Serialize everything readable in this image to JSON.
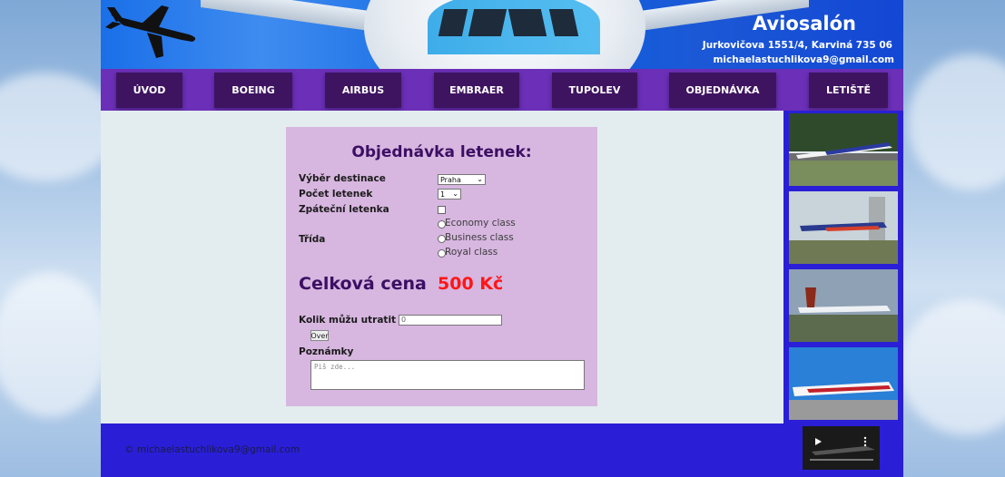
{
  "header": {
    "title": "Aviosalón",
    "address": "Jurkovičova 1551/4, Karviná 735 06",
    "email": "michaelastuchlikova9@gmail.com"
  },
  "nav": {
    "items": [
      {
        "label": "ÚVOD"
      },
      {
        "label": "BOEING"
      },
      {
        "label": "AIRBUS"
      },
      {
        "label": "EMBRAER"
      },
      {
        "label": "TUPOLEV"
      },
      {
        "label": "OBJEDNÁVKA"
      },
      {
        "label": "LETIŠTĚ"
      }
    ]
  },
  "form": {
    "title": "Objednávka letenek:",
    "destination_label": "Výběr destinace",
    "destination_value": "Praha",
    "tickets_label": "Počet letenek",
    "tickets_value": "1",
    "return_label": "Zpáteční letenka",
    "class_label": "Třída",
    "classes": [
      "Economy class",
      "Business class",
      "Royal class"
    ],
    "total_label": "Celková cena",
    "total_value": "500 Kč",
    "budget_label": "Kolik můžu utratit",
    "budget_value": "0",
    "check_button": "Over",
    "notes_label": "Poznámky",
    "notes_placeholder": "Piš zde..."
  },
  "footer": {
    "copyright": "©  michaelastuchlikova9@gmail.com"
  },
  "colors": {
    "nav_bg": "#6b2fb8",
    "nav_button": "#3e1460",
    "card_bg": "#d7b6e0",
    "title_color": "#3b0f63",
    "price_color": "#ff1616",
    "sidebar_bg": "#2a1fd6"
  }
}
